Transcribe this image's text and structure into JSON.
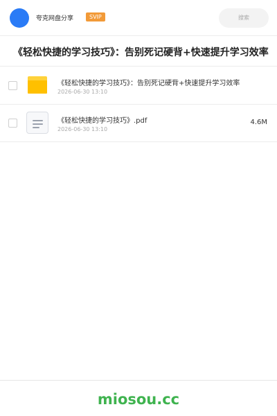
{
  "header": {
    "username": "夸克网盘分享",
    "badge": "SVIP",
    "search_placeholder": "搜索"
  },
  "page": {
    "title": "《轻松快捷的学习技巧》：告别死记硬背+快速提升学习效率"
  },
  "files": [
    {
      "type": "folder",
      "name": "《轻松快捷的学习技巧》：告别死记硬背+快速提升学习效率",
      "date": "2026-06-30 13:10",
      "size": ""
    },
    {
      "type": "document",
      "name": "《轻松快捷的学习技巧》.pdf",
      "date": "2026-06-30 13:10",
      "size": "4.6M"
    }
  ],
  "footer": {
    "brand": "miosou.cc"
  },
  "colors": {
    "avatar": "#2a7bf6",
    "svip_badge": "#f29a38",
    "folder": "#ffc000",
    "brand": "#3fb34f"
  },
  "icons": {
    "folder": "folder-icon",
    "document": "document-icon"
  }
}
